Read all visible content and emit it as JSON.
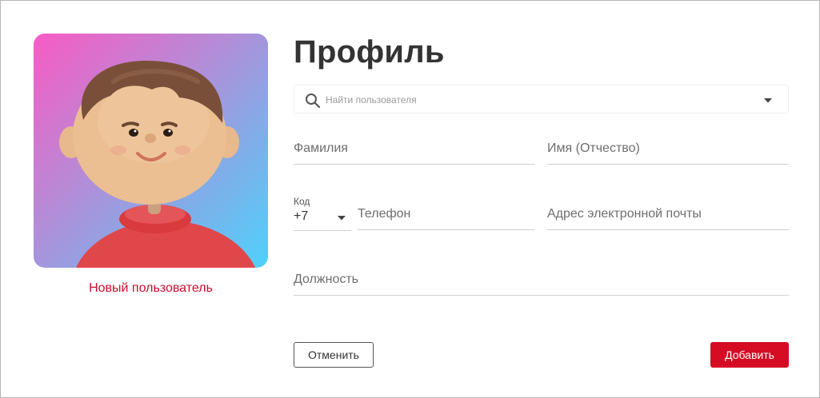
{
  "profile": {
    "title": "Профиль",
    "avatar": {
      "icon": "avatar-3d-boy-illustration"
    },
    "user_caption": "Новый пользователь"
  },
  "search": {
    "placeholder": "Найти пользователя",
    "value": "",
    "icon": "search-icon",
    "dropdown_icon": "caret-down-icon"
  },
  "form": {
    "last_name": {
      "placeholder": "Фамилия",
      "value": ""
    },
    "first_name": {
      "placeholder": "Имя (Отчество)",
      "value": ""
    },
    "phone_code": {
      "label": "Код",
      "value": "+7"
    },
    "phone": {
      "placeholder": "Телефон",
      "value": ""
    },
    "email": {
      "placeholder": "Адрес электронной почты",
      "value": ""
    },
    "position": {
      "placeholder": "Должность",
      "value": ""
    }
  },
  "actions": {
    "cancel_label": "Отменить",
    "add_label": "Добавить"
  },
  "colors": {
    "accent": "#d50c24",
    "caption": "#c8102e",
    "title": "#333333"
  }
}
